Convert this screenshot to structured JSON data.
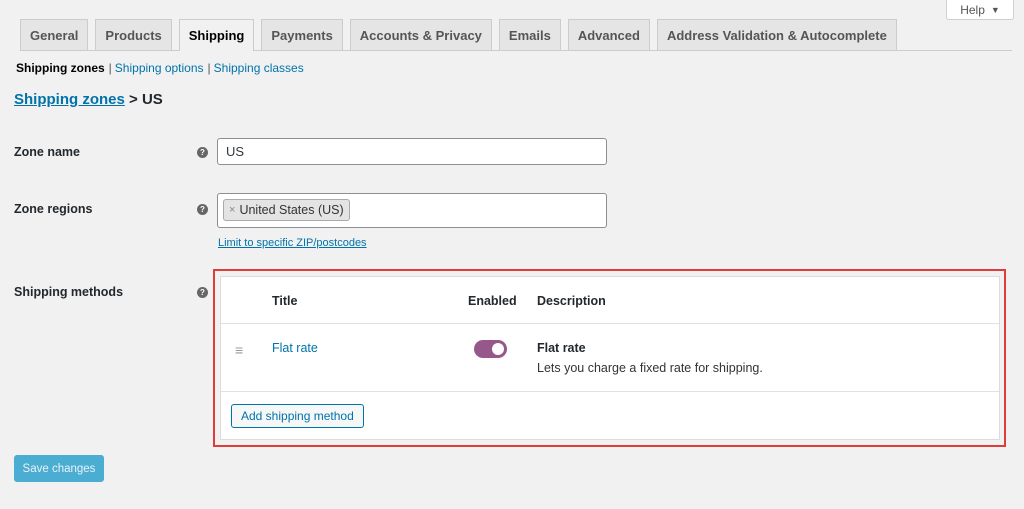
{
  "help": {
    "label": "Help",
    "caret": "▼"
  },
  "tabs": [
    {
      "label": "General"
    },
    {
      "label": "Products"
    },
    {
      "label": "Shipping"
    },
    {
      "label": "Payments"
    },
    {
      "label": "Accounts & Privacy"
    },
    {
      "label": "Emails"
    },
    {
      "label": "Advanced"
    },
    {
      "label": "Address Validation & Autocomplete"
    }
  ],
  "active_tab": "Shipping",
  "subnav": {
    "current": "Shipping zones",
    "options": "Shipping options",
    "classes": "Shipping classes",
    "separator": "|"
  },
  "breadcrumb": {
    "link": "Shipping zones",
    "separator": ">",
    "current": "US"
  },
  "zone_name": {
    "label": "Zone name",
    "value": "US"
  },
  "zone_regions": {
    "label": "Zone regions",
    "tokens": [
      {
        "remove": "×",
        "label": "United States (US)"
      }
    ],
    "zip_link": "Limit to specific ZIP/postcodes"
  },
  "shipping_methods": {
    "label": "Shipping methods",
    "columns": {
      "title": "Title",
      "enabled": "Enabled",
      "description": "Description"
    },
    "rows": [
      {
        "title": "Flat rate",
        "enabled": true,
        "desc_title": "Flat rate",
        "desc_text": "Lets you charge a fixed rate for shipping."
      }
    ],
    "add_button": "Add shipping method"
  },
  "save_button": "Save changes",
  "tooltip_glyph": "?",
  "drag_glyph": "≡",
  "colors": {
    "link": "#0073aa",
    "toggle_on": "#96588a",
    "highlight": "#e03c3c",
    "save": "#2ea2cc"
  }
}
